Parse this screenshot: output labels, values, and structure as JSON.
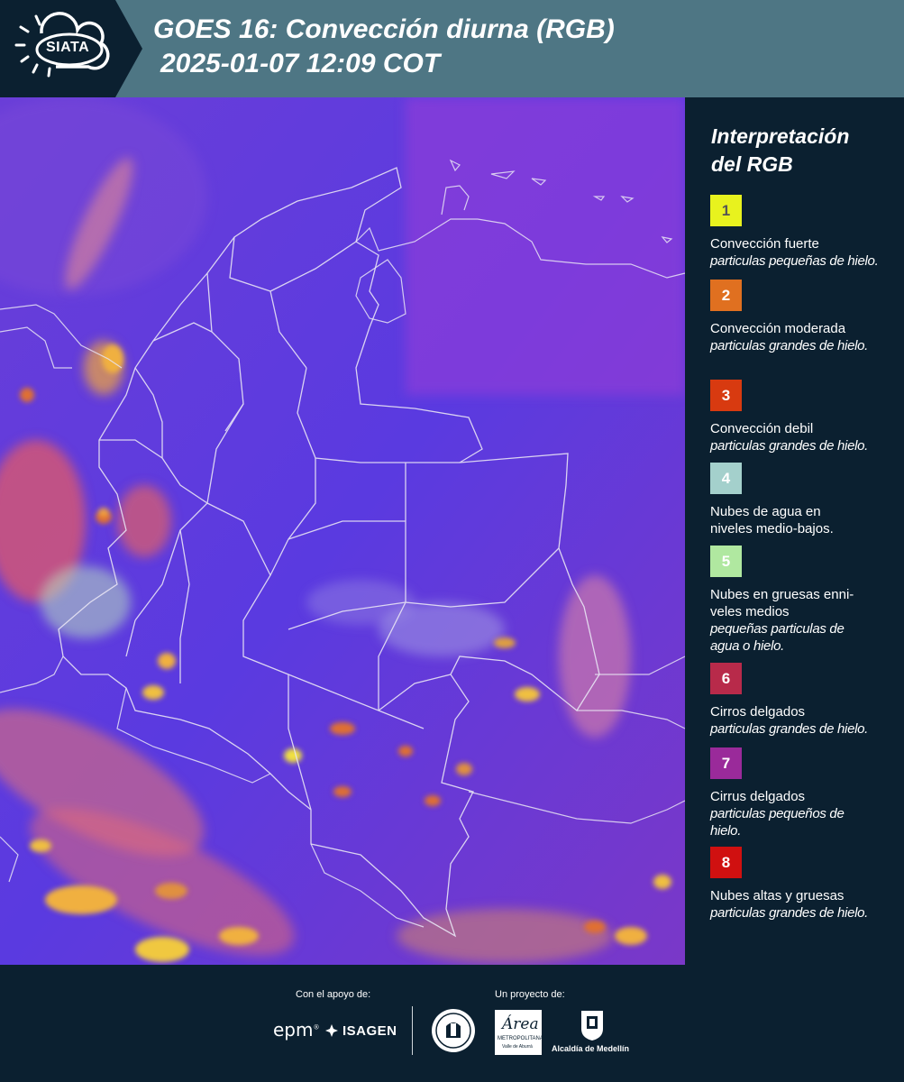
{
  "header": {
    "logo_text": "SIATA",
    "title_line1": "GOES 16: Convección diurna (RGB)",
    "title_line2": "2025-01-07 12:09 COT"
  },
  "map": {
    "product": "Convección diurna (RGB)",
    "base_color": "#6a3ae0"
  },
  "legend": {
    "title_line1": "Interpretación",
    "title_line2": "del RGB",
    "items": [
      {
        "number": "1",
        "color": "#e8f21e",
        "number_color": "#555555",
        "label": "Convección fuerte",
        "desc": "particulas pequeñas de hielo."
      },
      {
        "number": "2",
        "color": "#e07020",
        "number_color": "#ffffff",
        "label": "Convección moderada",
        "desc": "particulas grandes de hielo."
      },
      {
        "number": "3",
        "color": "#d83a10",
        "number_color": "#ffffff",
        "label": "Convección debil",
        "desc": "particulas grandes de hielo."
      },
      {
        "number": "4",
        "color": "#a4d0cc",
        "number_color": "#ffffff",
        "label": "Nubes de agua en niveles medio-bajos.",
        "desc": ""
      },
      {
        "number": "5",
        "color": "#b0e8a0",
        "number_color": "#ffffff",
        "label": "Nubes en gruesas enni-veles medios",
        "desc": "pequeñas particulas de agua o hielo."
      },
      {
        "number": "6",
        "color": "#b82a4a",
        "number_color": "#ffffff",
        "label": "Cirros delgados",
        "desc": "particulas grandes de hielo."
      },
      {
        "number": "7",
        "color": "#9a2a9a",
        "number_color": "#ffffff",
        "label": "Cirrus delgados",
        "desc": "particulas pequeños de hielo."
      },
      {
        "number": "8",
        "color": "#d01010",
        "number_color": "#ffffff",
        "label": "Nubes altas y gruesas",
        "desc": "particulas grandes de hielo."
      }
    ]
  },
  "footer": {
    "support_label": "Con el apoyo de:",
    "project_label": "Un proyecto de:",
    "sponsor1": "epm",
    "sponsor2": "ISAGEN",
    "partner1": "METROPOLITANA",
    "partner1_script": "Área",
    "partner1_sub": "Valle de Aburrá",
    "partner2": "Alcaldía de Medellín"
  }
}
